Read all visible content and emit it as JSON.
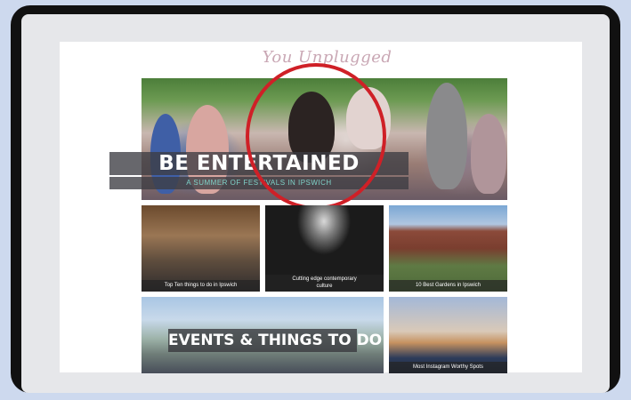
{
  "brand": "You Unplugged",
  "hero": {
    "title": "BE ENTERTAINED",
    "subtitle": "A SUMMER OF FESTIVALS IN IPSWICH",
    "highlight_color": "#cf2027"
  },
  "tiles": [
    {
      "caption": "Top Ten things to do in Ipswich"
    },
    {
      "caption_line1": "Cutting edge contemporary",
      "caption_line2": "culture"
    },
    {
      "caption": "10 Best Gardens in Ipswich"
    },
    {
      "title": "EVENTS & THINGS TO DO"
    },
    {
      "caption": "Most Instagram Worthy Spots"
    }
  ]
}
